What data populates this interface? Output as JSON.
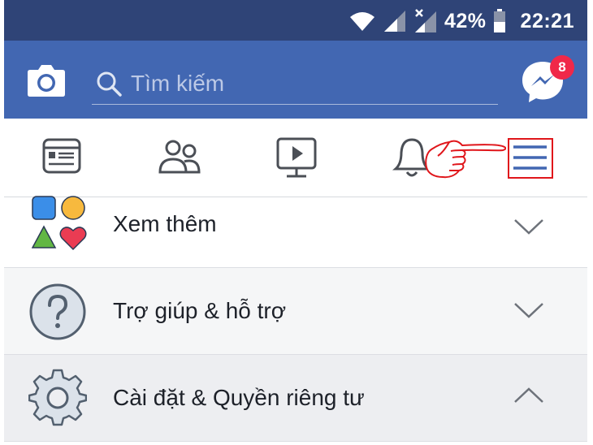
{
  "status_bar": {
    "battery_percent": "42%",
    "time": "22:21"
  },
  "header": {
    "search_placeholder": "Tìm kiếm",
    "messenger_badge": "8"
  },
  "tabs": [
    {
      "icon": "news-feed-icon"
    },
    {
      "icon": "friends-icon"
    },
    {
      "icon": "watch-icon"
    },
    {
      "icon": "notifications-bell-icon"
    },
    {
      "icon": "menu-hamburger-icon",
      "selected": true
    }
  ],
  "menu": {
    "items": [
      {
        "label": "Xem thêm",
        "icon": "see-more-shapes-icon",
        "expanded": false
      },
      {
        "label": "Trợ giúp & hỗ trợ",
        "icon": "help-question-icon",
        "expanded": false
      },
      {
        "label": "Cài đặt & Quyền riêng tư",
        "icon": "settings-gear-icon",
        "expanded": true
      }
    ]
  },
  "colors": {
    "brand_blue": "#4267b2",
    "status_bar": "#2f4477",
    "badge_red": "#f02849",
    "annotation_red": "#e0161b"
  }
}
